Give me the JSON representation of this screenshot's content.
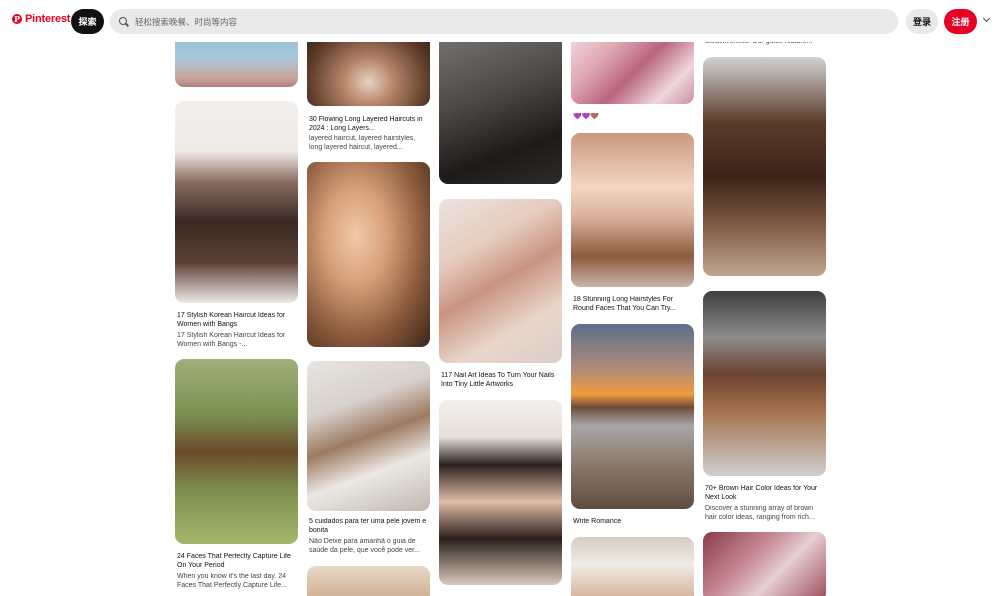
{
  "header": {
    "logo_mark": "P",
    "logo_text": "Pinterest",
    "explore_label": "探索",
    "search_placeholder": "轻松搜索晚餐、时尚等内容",
    "login_label": "登录",
    "signup_label": "注册"
  },
  "colors": {
    "brand": "#e60023",
    "search_bg": "#e9e9e9"
  },
  "icons": {
    "search": "search-icon",
    "more": "chevron-down-icon"
  },
  "pins": [
    {
      "title": "",
      "desc": ""
    },
    {
      "title": "17 Stylish Korean Haircut Ideas for Women with Bangs",
      "desc": "17 Stylish Korean Haircut Ideas for Women with Bangs -..."
    },
    {
      "title": "24 Faces That Perfectly Capture Life On Your Period",
      "desc": "When you know it's the last day. 24 Faces That Perfectly Capture Life..."
    },
    {
      "title": "30 Flowing Long Layered Haircuts in 2024 : Long Layers...",
      "desc": "layered haircut, layered hairstyles, long layered haircut, layered..."
    },
    {
      "title": "",
      "desc": ""
    },
    {
      "title": "5 cuidados para ter uma pele jovem e bonita",
      "desc": "Não Deixe para amanhã o guia de saúde da pele, que você pode ver..."
    },
    {
      "title": "",
      "desc": ""
    },
    {
      "title": "",
      "desc": ""
    },
    {
      "title": "117 Nail Art Ideas To Turn Your Nails Into Tiny Little Artworks",
      "desc": ""
    },
    {
      "title": "",
      "desc": ""
    },
    {
      "title": "💜💜🤎",
      "desc": ""
    },
    {
      "title": "18 Stunning Long Hairstyles For Round Faces That You Can Try...",
      "desc": ""
    },
    {
      "title": "Write Romance",
      "desc": ""
    },
    {
      "title": "",
      "desc": ""
    },
    {
      "title": "",
      "desc": "attractiveness. Our guide feature..."
    },
    {
      "title": "",
      "desc": ""
    },
    {
      "title": "70+ Brown Hair Color Ideas for Your Next Look",
      "desc": "Discover a stunning array of brown hair color ideas, ranging from rich..."
    },
    {
      "title": "",
      "desc": ""
    }
  ]
}
